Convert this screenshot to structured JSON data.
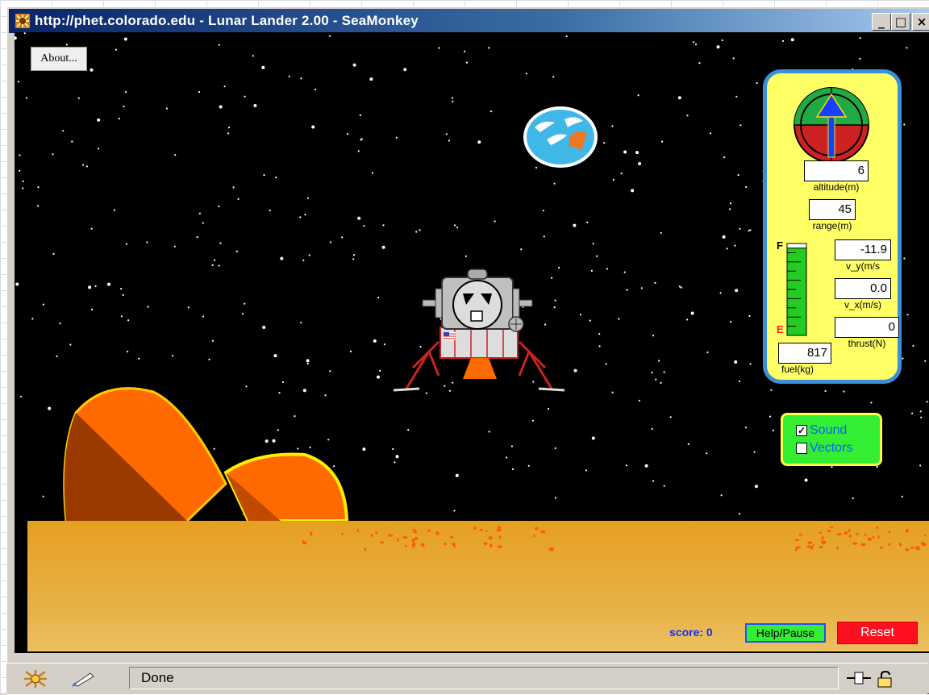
{
  "window": {
    "title": "http://phet.colorado.edu - Lunar Lander 2.00 - SeaMonkey",
    "controls": [
      "_",
      "□",
      "×"
    ]
  },
  "sim": {
    "about_label": "About...",
    "instruments": {
      "altitude": {
        "value": "6",
        "label": "altitude(m)"
      },
      "range": {
        "value": "45",
        "label": "range(m)"
      },
      "v_y": {
        "value": "-11.9",
        "label": "v_y(m/s"
      },
      "v_x": {
        "value": "0.0",
        "label": "v_x(m/s)"
      },
      "thrust": {
        "value": "0",
        "label": "thrust(N)"
      },
      "fuel": {
        "value": "817",
        "label": "fuel(kg)",
        "full_mark": "F",
        "empty_mark": "E",
        "level": 0.95
      }
    },
    "options": {
      "sound": {
        "label": "Sound",
        "checked": true
      },
      "vectors": {
        "label": "Vectors",
        "checked": false
      }
    },
    "score": "score: 0",
    "help_label": "Help/Pause",
    "reset_label": "Reset"
  },
  "statusbar": {
    "text": "Done"
  },
  "colors": {
    "panel_bg": "#ffff66",
    "panel_border": "#3b8fd6",
    "options_bg": "#33ee33",
    "reset_bg": "#ff1020",
    "ground": "#e8b24a"
  }
}
